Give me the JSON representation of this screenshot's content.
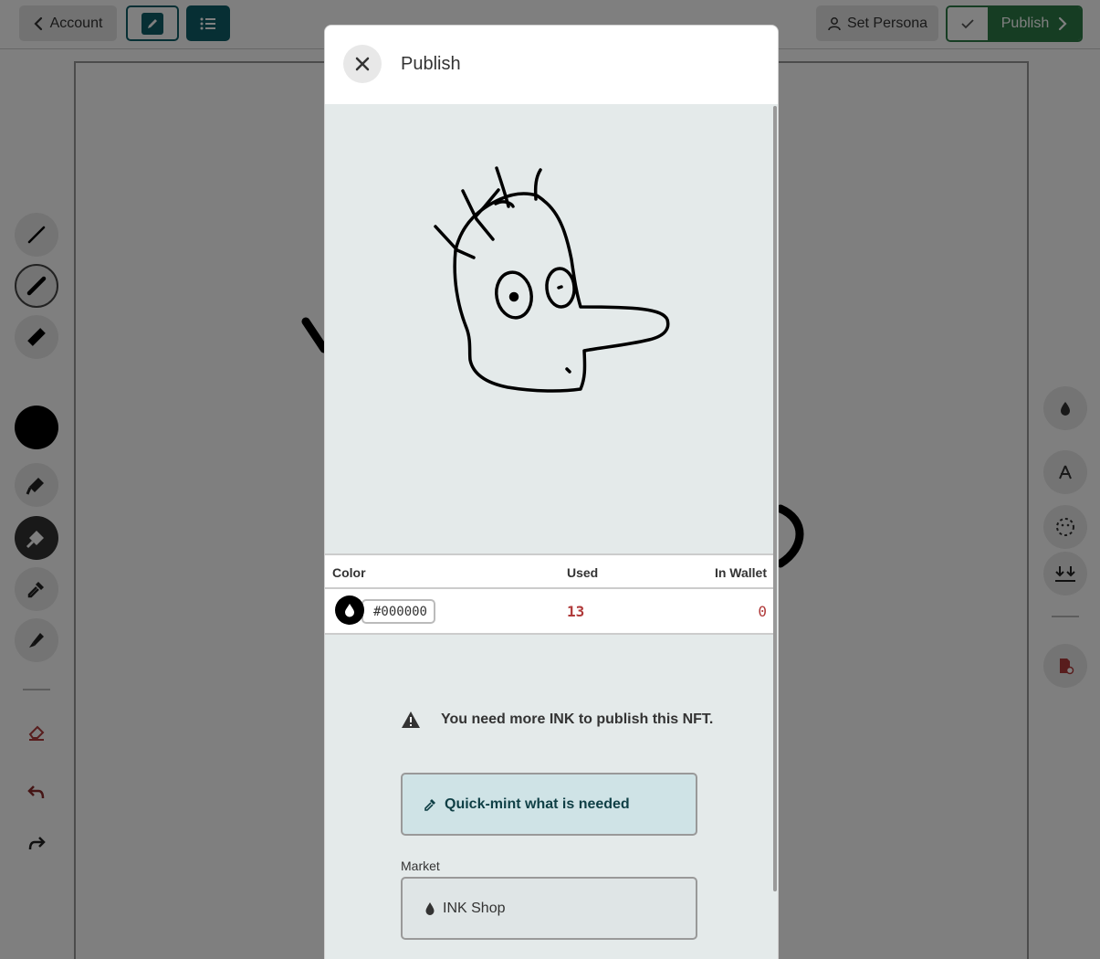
{
  "topbar": {
    "account_label": "Account",
    "persona_label": "Set Persona",
    "publish_label": "Publish"
  },
  "modal": {
    "title": "Publish",
    "table": {
      "headers": {
        "color": "Color",
        "used": "Used",
        "in_wallet": "In Wallet"
      },
      "rows": [
        {
          "color": "#000000",
          "used": "13",
          "in_wallet": "0"
        }
      ]
    },
    "warning_text": "You need more INK to publish this NFT.",
    "quickmint_label": "Quick-mint what is needed",
    "market_label": "Market",
    "market_option": "INK Shop"
  },
  "colors": {
    "brand_teal": "#0f5e68",
    "publish_green": "#2d7a46",
    "insufficient_red": "#b03a3a",
    "selected_ink": "#000000"
  }
}
